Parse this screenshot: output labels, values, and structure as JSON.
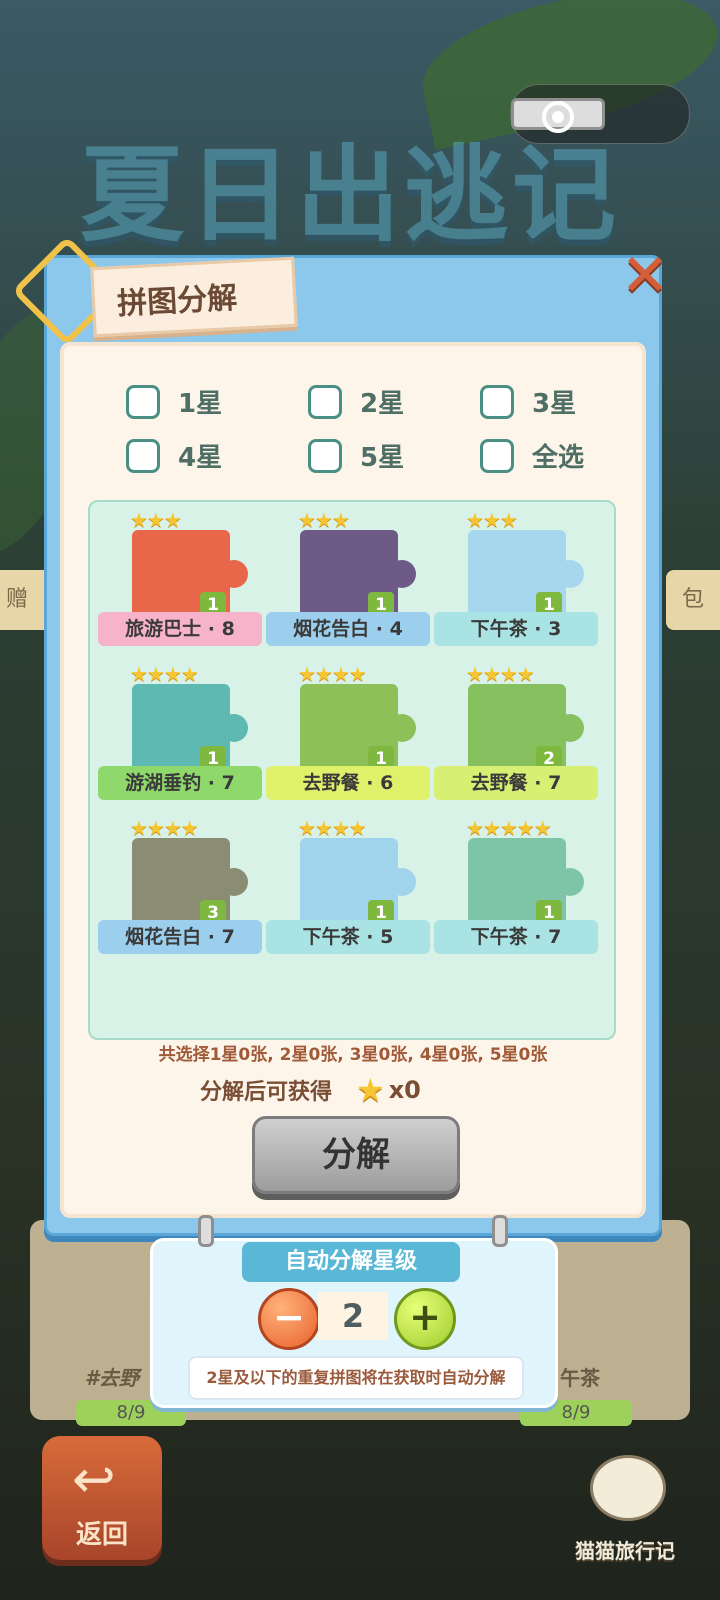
{
  "background": {
    "title": "夏日出逃记",
    "side_left": "赠",
    "side_right": "包",
    "behind_card_left": "#去野",
    "behind_card_right": "午茶",
    "behind_progress_left": "8/9",
    "behind_progress_right": "8/9"
  },
  "capsule": {
    "more": "•••",
    "record": "record-icon"
  },
  "dialog": {
    "title": "拼图分解",
    "close": "✕"
  },
  "filters": [
    {
      "label": "1星",
      "checked": false
    },
    {
      "label": "2星",
      "checked": false
    },
    {
      "label": "3星",
      "checked": false
    },
    {
      "label": "4星",
      "checked": false
    },
    {
      "label": "5星",
      "checked": false
    },
    {
      "label": "全选",
      "checked": false
    }
  ],
  "puzzles": [
    {
      "stars": "★★★",
      "name": "旅游巴士 · 8",
      "count": "1",
      "ribbon": "#f6b3c9",
      "pic": "#e8674a"
    },
    {
      "stars": "★★★",
      "name": "烟花告白 · 4",
      "count": "1",
      "ribbon": "#9ccfee",
      "pic": "#6d5a86"
    },
    {
      "stars": "★★★",
      "name": "下午茶 · 3",
      "count": "1",
      "ribbon": "#a9e3e3",
      "pic": "#a7d7ee"
    },
    {
      "stars": "★★★★",
      "name": "游湖垂钓 · 7",
      "count": "1",
      "ribbon": "#8fd86b",
      "pic": "#5fb9b3"
    },
    {
      "stars": "★★★★",
      "name": "去野餐 · 6",
      "count": "1",
      "ribbon": "#dff06a",
      "pic": "#8ec05a"
    },
    {
      "stars": "★★★★",
      "name": "去野餐 · 7",
      "count": "2",
      "ribbon": "#d7ef73",
      "pic": "#86c05f"
    },
    {
      "stars": "★★★★",
      "name": "烟花告白 · 7",
      "count": "3",
      "ribbon": "#9ccfee",
      "pic": "#8a8c73"
    },
    {
      "stars": "★★★★",
      "name": "下午茶 · 5",
      "count": "1",
      "ribbon": "#a9e3e3",
      "pic": "#9fd4ec"
    },
    {
      "stars": "★★★★★",
      "name": "下午茶 · 7",
      "count": "1",
      "ribbon": "#a9e3e3",
      "pic": "#7ec4a6"
    }
  ],
  "summary": "共选择1星0张, 2星0张, 3星0张, 4星0张, 5星0张",
  "gain": {
    "label": "分解后可获得",
    "icon": "star-icon",
    "value": "x0"
  },
  "decompose_button": "分解",
  "auto": {
    "title": "自动分解星级",
    "minus": "−",
    "plus": "+",
    "level": "2",
    "tip": "2星及以下的重复拼图将在获取时自动分解"
  },
  "bottom": {
    "back_label": "返回",
    "back_icon": "↩",
    "mascot_label": "猫猫旅行记"
  }
}
